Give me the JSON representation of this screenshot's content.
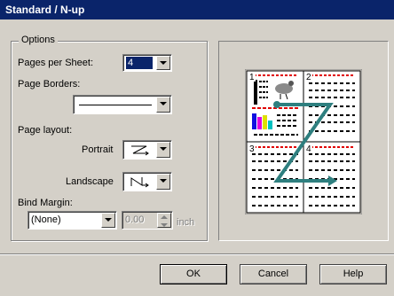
{
  "window": {
    "title": "Standard / N-up"
  },
  "options": {
    "group_label": "Options",
    "pages_per_sheet": {
      "label": "Pages per Sheet:",
      "value": "4"
    },
    "page_borders": {
      "label": "Page Borders:"
    },
    "page_layout": {
      "label": "Page layout:",
      "portrait_label": "Portrait",
      "landscape_label": "Landscape"
    },
    "bind_margin": {
      "label": "Bind Margin:",
      "value": "(None)",
      "amount": "0.00",
      "unit": "inch"
    }
  },
  "preview": {
    "page_numbers": [
      "1",
      "2",
      "3",
      "4"
    ]
  },
  "buttons": {
    "ok": "OK",
    "cancel": "Cancel",
    "help": "Help"
  },
  "colors": {
    "title_bg": "#0a246a",
    "arrow": "#2e7f7f"
  }
}
